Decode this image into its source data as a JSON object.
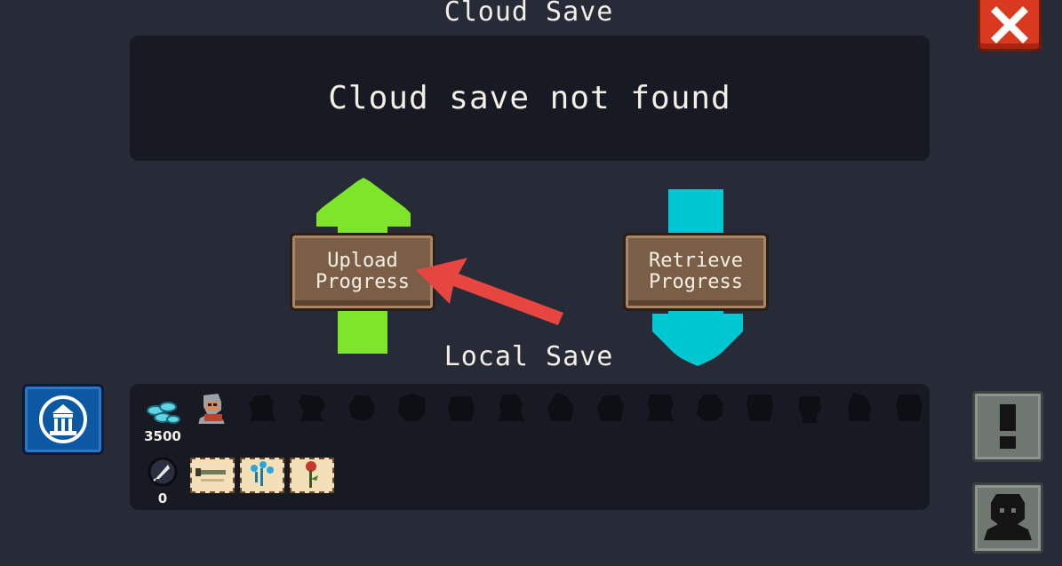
{
  "cloud": {
    "title": "Cloud Save",
    "status": "Cloud save not found"
  },
  "actions": {
    "upload_line1": "Upload",
    "upload_line2": "Progress",
    "retrieve_line1": "Retrieve",
    "retrieve_line2": "Progress"
  },
  "local": {
    "title": "Local Save",
    "coins": "3500",
    "feathers": "0"
  },
  "icons": {
    "close": "close-icon",
    "alert": "exclamation-icon",
    "profile": "person-silhouette-icon",
    "temple": "temple-icon",
    "coins": "coins-icon",
    "feather": "feather-icon"
  },
  "colors": {
    "background": "#272b38",
    "panel": "#171a23",
    "upload_arrow": "#7ee52a",
    "retrieve_arrow": "#00c8d2",
    "close_button": "#d8391f",
    "pointer_arrow": "#e74640"
  }
}
